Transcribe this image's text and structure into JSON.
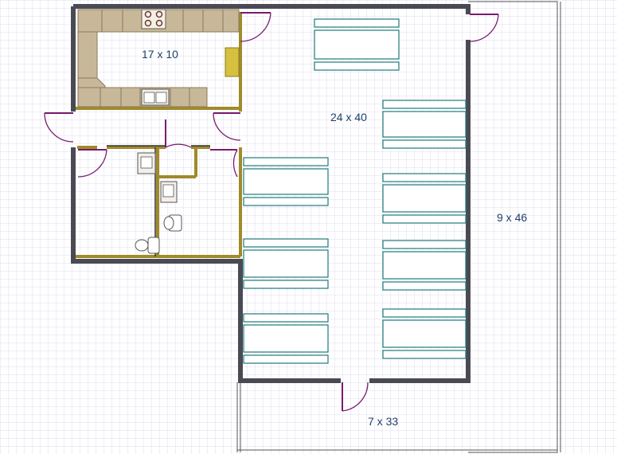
{
  "room_labels": {
    "kitchen": "17 x 10",
    "main": "24 x 40",
    "porch_right": "9 x 46",
    "porch_bottom": "7 x 33"
  },
  "colors": {
    "grid": "#dcdcf0",
    "wall": "#4a4a55",
    "wall_fill": "#6a6a76",
    "door": "#7a1a6e",
    "bed": "#1f7a7a",
    "counter": "#c8b89a",
    "partition": "#a08a2a",
    "label": "#1f3f6a"
  },
  "icons": {
    "door": "door-swing-icon",
    "bed": "bed-icon",
    "sink": "sink-icon",
    "stove": "stove-icon",
    "toilet": "toilet-icon"
  }
}
